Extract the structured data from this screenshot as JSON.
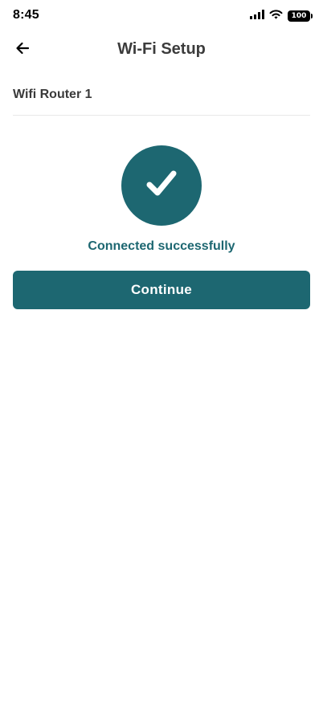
{
  "status_bar": {
    "time": "8:45",
    "battery_level": "100",
    "icons": [
      "signal-icon",
      "wifi-icon",
      "battery-icon"
    ]
  },
  "header": {
    "title": "Wi-Fi Setup",
    "back_icon": "arrow-left-icon"
  },
  "network": {
    "name": "Wifi Router 1"
  },
  "status": {
    "icon": "check-icon",
    "message": "Connected successfully"
  },
  "actions": {
    "continue_label": "Continue"
  },
  "colors": {
    "accent": "#1d6771",
    "background": "#ffffff",
    "title_text": "#3c3c3c",
    "divider": "#e8e8e8"
  }
}
